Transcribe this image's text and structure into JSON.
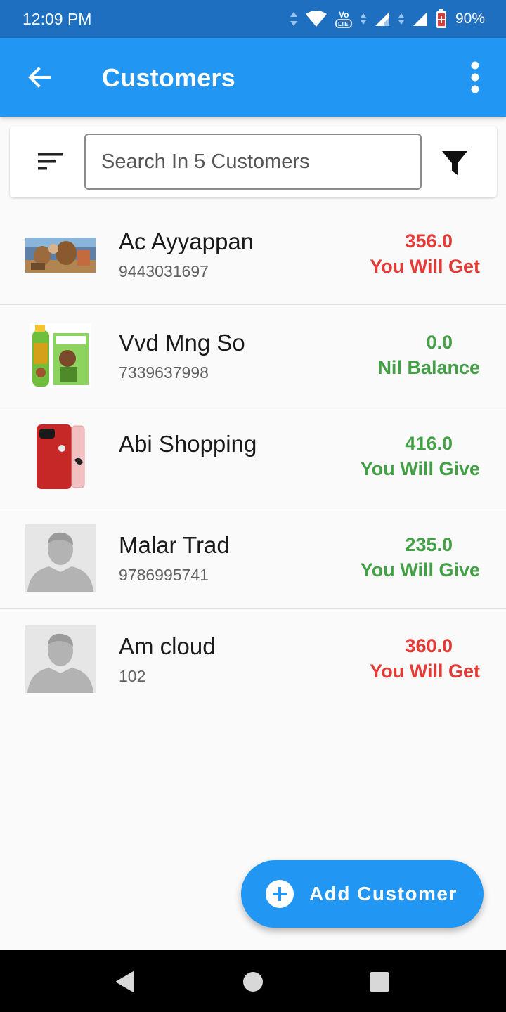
{
  "status_bar": {
    "time": "12:09 PM",
    "battery_percent": "90%",
    "icons": [
      "data-arrows-icon",
      "wifi-icon",
      "volte-icon",
      "signal-icon",
      "signal-icon",
      "battery-icon"
    ]
  },
  "app_bar": {
    "title": "Customers",
    "back_icon": "arrow-back-icon",
    "menu_icon": "more-vert-icon",
    "background": "#2196f3"
  },
  "search": {
    "placeholder": "Search In 5 Customers",
    "value": "",
    "sort_icon": "sort-icon",
    "filter_icon": "filter-icon"
  },
  "customers": [
    {
      "name": "Ac Ayyappan",
      "phone": "9443031697",
      "amount": "356.0",
      "label": "You Will Get",
      "status_color": "#e53935",
      "avatar": "photo-thumbnail"
    },
    {
      "name": "Vvd Mng So",
      "phone": "7339637998",
      "amount": "0.0",
      "label": "Nil Balance",
      "status_color": "#43a047",
      "avatar": "product-thumbnail"
    },
    {
      "name": "Abi Shopping",
      "phone": "",
      "amount": "416.0",
      "label": "You Will Give",
      "status_color": "#43a047",
      "avatar": "phone-thumbnail"
    },
    {
      "name": "Malar Trad",
      "phone": "9786995741",
      "amount": "235.0",
      "label": "You Will Give",
      "status_color": "#43a047",
      "avatar": "default-person-avatar"
    },
    {
      "name": "Am cloud",
      "phone": "102",
      "amount": "360.0",
      "label": "You Will Get",
      "status_color": "#e53935",
      "avatar": "default-person-avatar"
    }
  ],
  "fab": {
    "label": "Add Customer",
    "icon": "add-circle-icon"
  },
  "nav_bar": {
    "icons": [
      "back-triangle-icon",
      "home-circle-icon",
      "recents-square-icon"
    ]
  }
}
